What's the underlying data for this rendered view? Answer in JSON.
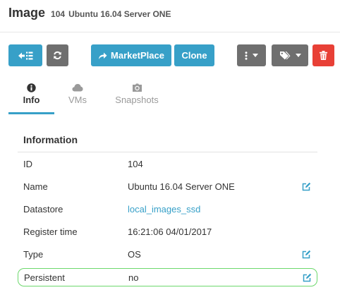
{
  "header": {
    "kind": "Image",
    "id": "104",
    "name": "Ubuntu 16.04 Server ONE"
  },
  "toolbar": {
    "back": {
      "icon": "back-list-icon"
    },
    "refresh": {
      "icon": "refresh-icon"
    },
    "marketplace": {
      "label": "MarketPlace",
      "icon": "share-arrow-icon"
    },
    "clone": {
      "label": "Clone"
    },
    "more_menu": {
      "icon": "vertical-dots-icon"
    },
    "labels_menu": {
      "icon": "tags-icon"
    },
    "delete": {
      "icon": "trash-icon"
    }
  },
  "tabs": [
    {
      "label": "Info",
      "icon": "info-circle-icon",
      "active": true
    },
    {
      "label": "VMs",
      "icon": "cloud-icon",
      "active": false
    },
    {
      "label": "Snapshots",
      "icon": "camera-icon",
      "active": false
    }
  ],
  "info": {
    "title": "Information",
    "rows": [
      {
        "key": "ID",
        "value": "104",
        "editable": false
      },
      {
        "key": "Name",
        "value": "Ubuntu 16.04 Server ONE",
        "editable": true
      },
      {
        "key": "Datastore",
        "value": "local_images_ssd",
        "editable": false,
        "link": true
      },
      {
        "key": "Register time",
        "value": "16:21:06 04/01/2017",
        "editable": false
      },
      {
        "key": "Type",
        "value": "OS",
        "editable": true
      },
      {
        "key": "Persistent",
        "value": "no",
        "editable": true,
        "highlighted": true
      }
    ]
  },
  "colors": {
    "primary": "#37a0c8",
    "secondary": "#6f6f6f",
    "danger": "#e84036",
    "highlight": "#6cd86c"
  }
}
